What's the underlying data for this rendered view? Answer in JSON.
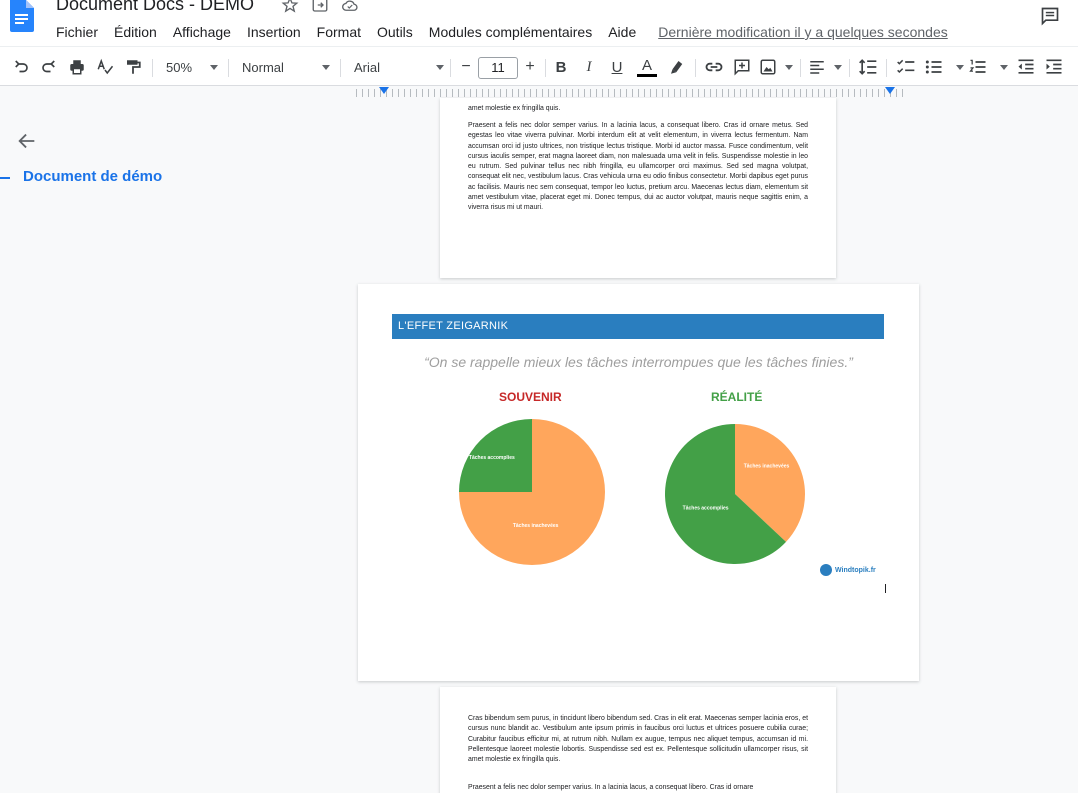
{
  "app": {
    "title": "Document Docs - DEMO",
    "last_modified": "Dernière modification il y a quelques secondes"
  },
  "menu": [
    "Fichier",
    "Édition",
    "Affichage",
    "Insertion",
    "Format",
    "Outils",
    "Modules complémentaires",
    "Aide"
  ],
  "toolbar": {
    "zoom": "50%",
    "style": "Normal",
    "font": "Arial",
    "font_size": "11",
    "minus": "−",
    "plus": "+",
    "bold": "B",
    "italic": "I",
    "underline": "U",
    "text_color": "A"
  },
  "sidebar": {
    "outline_item": "Document de démo"
  },
  "pages": {
    "p1_para1_tail": "amet molestie ex fringilla quis.",
    "p1_para2": "Praesent a felis nec dolor semper varius. In a lacinia lacus, a consequat libero. Cras id ornare metus. Sed egestas leo vitae viverra pulvinar. Morbi interdum elit at velit elementum, in viverra lectus fermentum. Nam accumsan orci id justo ultrices, non tristique lectus tristique. Morbi id auctor massa. Fusce condimentum, velit cursus iaculis semper, erat magna laoreet diam, non malesuada urna velit in felis. Suspendisse molestie in leo eu rutrum. Sed pulvinar tellus nec nibh fringilla, eu ullamcorper orci maximus. Sed sed magna volutpat, consequat elit nec, vestibulum lacus. Cras vehicula urna eu odio finibus consectetur. Morbi dapibus eget purus ac facilisis. Mauris nec sem consequat, tempor leo luctus, pretium arcu. Maecenas lectus diam, elementum sit amet vestibulum vitae, placerat eget mi. Donec tempus, dui ac auctor volutpat, mauris neque sagittis enim, a viverra risus mi ut mauri.",
    "p3_para1": "Cras bibendum sem purus, in tincidunt libero bibendum sed. Cras in elit erat. Maecenas semper lacinia eros, et cursus nunc blandit ac. Vestibulum ante ipsum primis in faucibus orci luctus et ultrices posuere cubilia curae; Curabitur faucibus efficitur mi, at rutrum nibh. Nullam ex augue, tempus nec aliquet tempus, accumsan id mi. Pellentesque laoreet molestie lobortis. Suspendisse sed est ex. Pellentesque sollicitudin ullamcorper risus, sit amet molestie ex fringilla quis.",
    "p3_para2": "Praesent a felis nec dolor semper varius. In a lacinia lacus, a consequat libero. Cras id ornare"
  },
  "infographic": {
    "banner": "L'EFFET ZEIGARNIK",
    "quote": "“On se rappelle mieux les tâches interrompues que les tâches finies.”",
    "left_title": "SOUVENIR",
    "right_title": "RÉALITÉ",
    "brand": "Windtopik.fr",
    "colors": {
      "banner": "#2a7ebf",
      "orange": "#ffa65c",
      "green": "#43a047",
      "red": "#c62828"
    }
  },
  "chart_data": [
    {
      "type": "pie",
      "title": "SOUVENIR",
      "categories": [
        "Tâches accomplies",
        "Tâches inachevées"
      ],
      "values": [
        25,
        75
      ],
      "colors": [
        "#43a047",
        "#ffa65c"
      ]
    },
    {
      "type": "pie",
      "title": "RÉALITÉ",
      "categories": [
        "Tâches inachevées",
        "Tâches accomplies"
      ],
      "values": [
        37,
        63
      ],
      "colors": [
        "#ffa65c",
        "#43a047"
      ]
    }
  ]
}
